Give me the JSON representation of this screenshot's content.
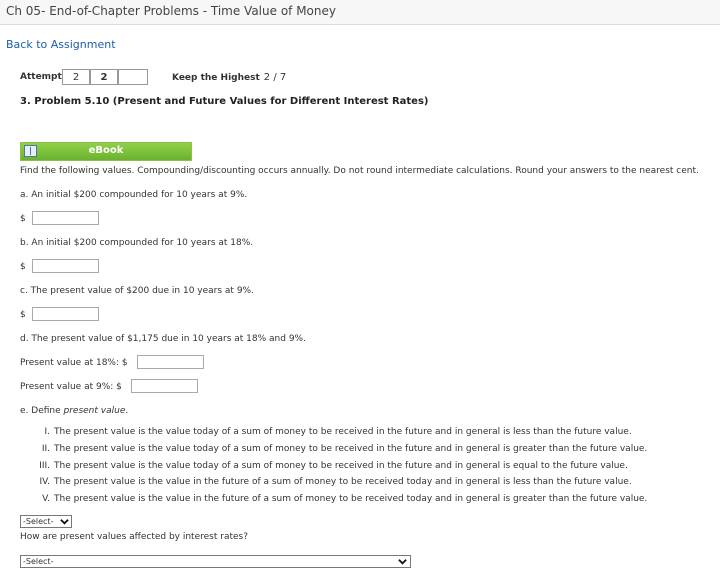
{
  "header": {
    "title": "Ch 05- End-of-Chapter Problems - Time Value of Money"
  },
  "nav": {
    "back_label": "Back to Assignment"
  },
  "attempts": {
    "label": "Attempts",
    "boxes": [
      "2",
      "2",
      ""
    ]
  },
  "keep": {
    "label": "Keep the Highest",
    "value": "2 / 7"
  },
  "problem": {
    "title": "3.  Problem 5.10 (Present and Future Values for Different Interest Rates)"
  },
  "ebook": {
    "label": "eBook",
    "icon": "book-icon"
  },
  "instructions": "Find the following values. Compounding/discounting occurs annually. Do not round intermediate calculations. Round your answers to the nearest cent.",
  "parts": {
    "a": "a. An initial $200 compounded for 10 years at 9%.",
    "b": "b. An initial $200 compounded for 10 years at 18%.",
    "c": "c. The present value of $200 due in 10 years at 9%.",
    "d": "d. The present value of $1,175 due in 10 years at 18% and 9%.",
    "d_18_label": "Present value at 18%: $",
    "d_9_label": "Present value at 9%: $",
    "e_prefix": "e. Define ",
    "e_term": "present value",
    "e_suffix": "."
  },
  "currency_symbol": "$",
  "options": [
    {
      "num": "I.",
      "text": "The present value is the value today of a sum of money to be received in the future and in general is less than the future value."
    },
    {
      "num": "II.",
      "text": "The present value is the value today of a sum of money to be received in the future and in general is greater than the future value."
    },
    {
      "num": "III.",
      "text": "The present value is the value today of a sum of money to be received in the future and in general is equal to the future value."
    },
    {
      "num": "IV.",
      "text": "The present value is the value in the future of a sum of money to be received today and in general is less than the future value."
    },
    {
      "num": "V.",
      "text": "The present value is the value in the future of a sum of money to be received today and in general is greater than the future value."
    }
  ],
  "select_e": {
    "value": "-Select-"
  },
  "question_f": "How are present values affected by interest rates?",
  "select_f": {
    "value": "-Select-"
  }
}
